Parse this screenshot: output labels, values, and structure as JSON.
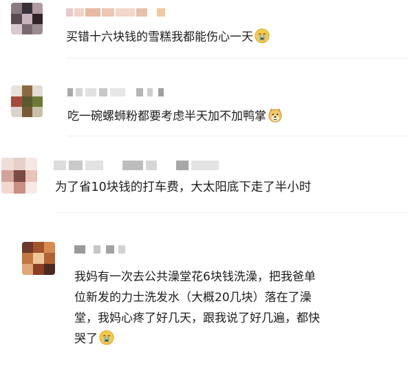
{
  "comments": [
    {
      "text": "买错十六块钱的雪糕我都能伤心一天",
      "emoji": "crying-face-icon"
    },
    {
      "text": "吃一碗螺蛳粉都要考虑半天加不加鸭掌",
      "emoji": "doge-face-icon"
    },
    {
      "text": "为了省10块钱的打车费，大太阳底下走了半小时"
    },
    {
      "lines": [
        "我妈有一次去公共澡堂花6块钱洗澡，把我爸单",
        "位新发的力士洗发水（大概20几块）落在了澡",
        "堂，我妈心疼了好几天，跟我说了好几遍，都快",
        "哭了"
      ],
      "emoji": "crying-face-icon"
    }
  ]
}
